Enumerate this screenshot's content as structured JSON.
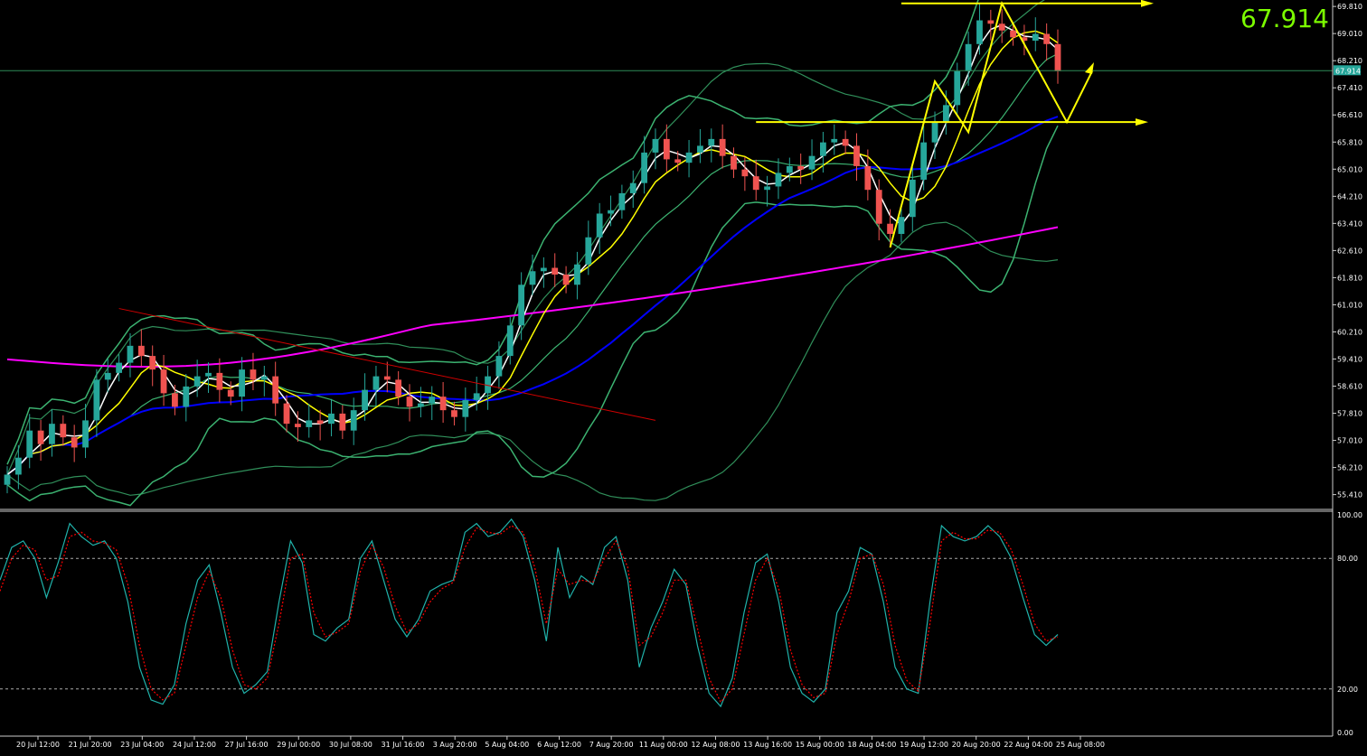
{
  "window": {
    "current_price_label": "67.914",
    "current_price_tag": "67.914"
  },
  "colors": {
    "background": "#000000",
    "bull_candle": "#26a69a",
    "bear_candle": "#ef5350",
    "bollinger": "#3cb371",
    "ma_fast": "#ffffff",
    "ma_mid": "#ffff00",
    "ma_slow": "#0000ff",
    "ma_200": "#ff00ff",
    "trendline": "#d00000",
    "annotation": "#ffff00",
    "stoch_main": "#20b2aa",
    "stoch_signal": "#ff0000",
    "axis_text": "#ffffff",
    "price_readout": "#7CFC00"
  },
  "chart_data": [
    {
      "type": "candlestick",
      "title": "",
      "price_axis": {
        "ticks": [
          "69.810",
          "69.010",
          "68.210",
          "67.410",
          "66.610",
          "65.810",
          "65.010",
          "64.210",
          "63.410",
          "62.610",
          "61.810",
          "61.010",
          "60.210",
          "59.410",
          "58.610",
          "57.810",
          "57.010",
          "56.210",
          "55.410"
        ],
        "range": [
          55.0,
          70.0
        ]
      },
      "time_axis": {
        "ticks": [
          "20 Jul 12:00",
          "21 Jul 20:00",
          "23 Jul 04:00",
          "24 Jul 12:00",
          "27 Jul 16:00",
          "29 Jul 00:00",
          "30 Jul 08:00",
          "31 Jul 16:00",
          "3 Aug 20:00",
          "5 Aug 04:00",
          "6 Aug 12:00",
          "7 Aug 20:00",
          "11 Aug 00:00",
          "12 Aug 08:00",
          "13 Aug 16:00",
          "15 Aug 00:00",
          "18 Aug 04:00",
          "19 Aug 12:00",
          "20 Aug 20:00",
          "22 Aug 04:00",
          "25 Aug 08:00"
        ]
      },
      "current_price": 67.914,
      "horizontal_level": 67.914,
      "key_prices": {
        "ma200_start": 59.4,
        "ma200_end": 63.3,
        "ma_slow_end": 66.2,
        "resistance": 69.9,
        "support": 66.4
      },
      "close_series": [
        56.0,
        56.5,
        57.3,
        56.9,
        57.5,
        57.1,
        56.8,
        57.6,
        58.8,
        59.0,
        59.3,
        59.8,
        59.5,
        59.1,
        58.4,
        58.0,
        58.6,
        58.9,
        59.0,
        58.5,
        58.3,
        59.1,
        58.8,
        58.9,
        58.1,
        57.5,
        57.4,
        57.6,
        57.5,
        57.8,
        57.3,
        57.9,
        58.5,
        58.9,
        58.8,
        58.3,
        58.0,
        58.1,
        58.3,
        57.9,
        57.7,
        58.2,
        58.4,
        58.9,
        59.5,
        60.4,
        61.6,
        62.0,
        62.1,
        61.9,
        61.6,
        62.2,
        63.0,
        63.7,
        63.8,
        64.3,
        64.6,
        65.5,
        65.9,
        65.3,
        65.2,
        65.5,
        65.7,
        65.9,
        65.4,
        65.0,
        64.8,
        64.4,
        64.5,
        64.9,
        65.1,
        65.0,
        65.4,
        65.8,
        65.9,
        65.7,
        65.1,
        64.4,
        63.4,
        63.1,
        63.6,
        64.7,
        65.8,
        66.4,
        66.9,
        67.9,
        68.7,
        69.4,
        69.3,
        69.1,
        68.9,
        68.8,
        69.0,
        68.7,
        67.9
      ],
      "indicators": [
        {
          "name": "MA fast",
          "color": "#ffffff"
        },
        {
          "name": "MA mid",
          "color": "#ffff00"
        },
        {
          "name": "MA slow",
          "color": "#0000ff"
        },
        {
          "name": "MA 200",
          "color": "#ff00ff"
        },
        {
          "name": "Bollinger Bands",
          "color": "#3cb371"
        }
      ]
    },
    {
      "type": "line",
      "title": "",
      "y_axis": {
        "ticks": [
          "100.00",
          "80.00",
          "20.00",
          "0.00"
        ],
        "range": [
          0,
          100
        ]
      },
      "levels": [
        80,
        20
      ],
      "series": [
        {
          "color": "#20b2aa",
          "values": [
            70,
            85,
            88,
            80,
            62,
            78,
            96,
            90,
            86,
            88,
            80,
            60,
            30,
            15,
            13,
            22,
            50,
            70,
            77,
            55,
            30,
            18,
            22,
            28,
            60,
            88,
            78,
            45,
            42,
            48,
            52,
            80,
            88,
            70,
            52,
            44,
            52,
            65,
            68,
            70,
            92,
            96,
            90,
            92,
            98,
            90,
            70,
            42,
            85,
            62,
            72,
            68,
            85,
            90,
            70,
            30,
            48,
            60,
            75,
            68,
            40,
            18,
            12,
            25,
            55,
            78,
            82,
            60,
            30,
            18,
            14,
            20,
            55,
            65,
            85,
            82,
            60,
            30,
            20,
            18,
            60,
            95,
            90,
            88,
            90,
            95,
            90,
            80,
            62,
            45,
            40,
            45
          ]
        },
        {
          "color": "#ff0000",
          "values": [
            65,
            80,
            86,
            84,
            70,
            72,
            90,
            92,
            88,
            87,
            84,
            68,
            40,
            20,
            15,
            18,
            40,
            62,
            74,
            62,
            38,
            22,
            20,
            25,
            50,
            80,
            82,
            55,
            44,
            46,
            50,
            74,
            86,
            76,
            58,
            46,
            50,
            60,
            66,
            69,
            85,
            94,
            92,
            91,
            95,
            92,
            76,
            50,
            75,
            68,
            70,
            69,
            80,
            88,
            76,
            40,
            44,
            55,
            70,
            70,
            48,
            25,
            14,
            20,
            45,
            70,
            80,
            66,
            38,
            22,
            16,
            18,
            45,
            60,
            80,
            82,
            68,
            40,
            24,
            19,
            50,
            88,
            92,
            89,
            89,
            93,
            92,
            84,
            68,
            50,
            42,
            44
          ]
        }
      ]
    }
  ]
}
